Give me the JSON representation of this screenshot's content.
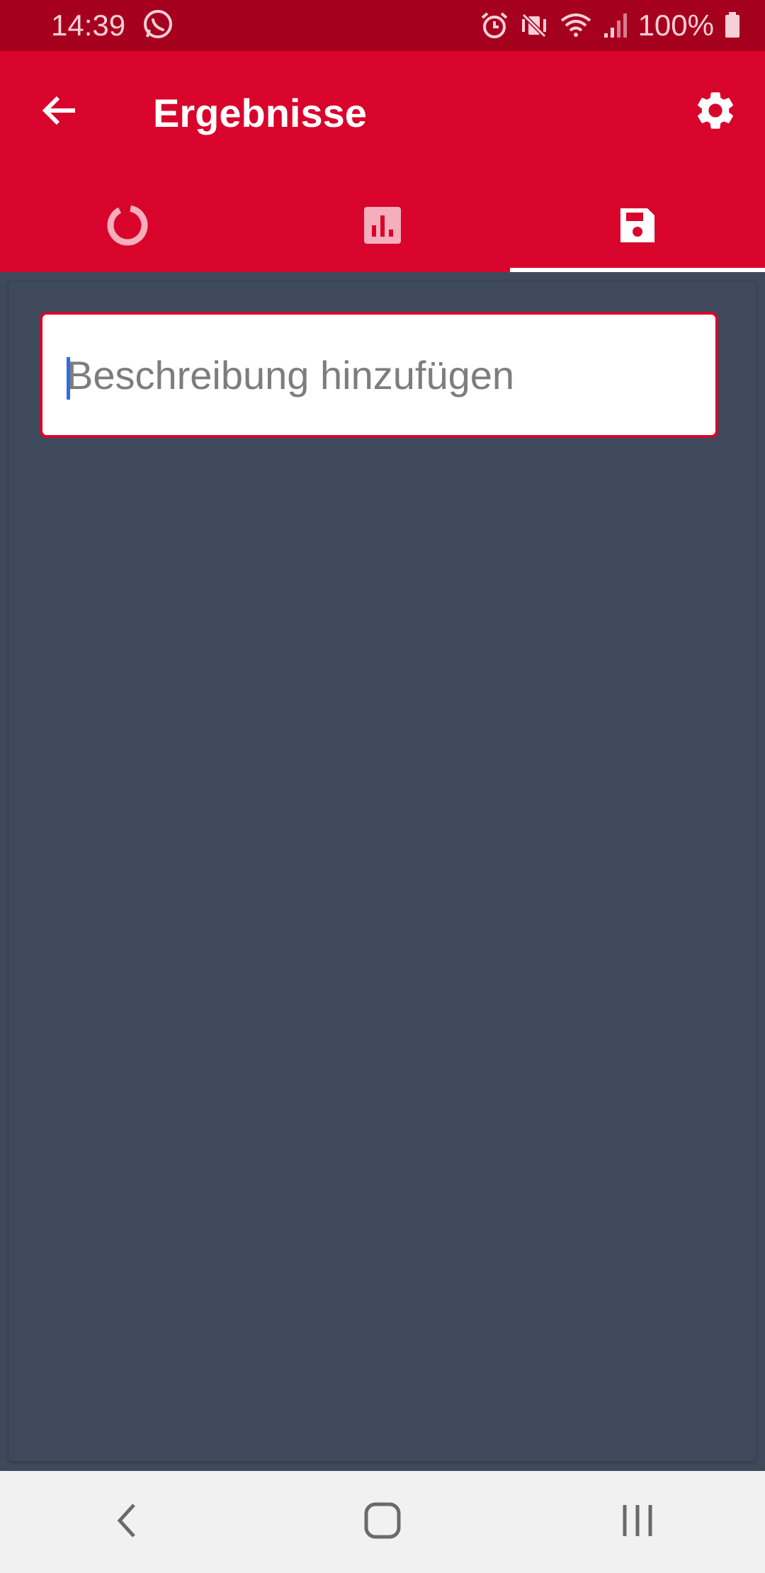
{
  "status_bar": {
    "time": "14:39",
    "battery": "100%",
    "icons": [
      "whatsapp-icon",
      "alarm-icon",
      "vibrate-off-icon",
      "wifi-icon",
      "signal-icon",
      "battery-icon"
    ]
  },
  "app_bar": {
    "title": "Ergebnisse",
    "back_icon": "arrow-back-icon",
    "settings_icon": "gear-icon"
  },
  "tabs": [
    {
      "icon": "donut-chart-icon",
      "selected": false
    },
    {
      "icon": "bar-chart-icon",
      "selected": false
    },
    {
      "icon": "save-icon",
      "selected": true
    }
  ],
  "description": {
    "placeholder": "Beschreibung hinzufügen",
    "value": ""
  },
  "nav_bar": {
    "icons": [
      "nav-back-icon",
      "nav-home-icon",
      "nav-recents-icon"
    ]
  },
  "colors": {
    "status_bar": "#a6001f",
    "app_bar": "#d9042b",
    "content_bg": "#3e495c",
    "nav_bar": "#f1f1f1"
  }
}
